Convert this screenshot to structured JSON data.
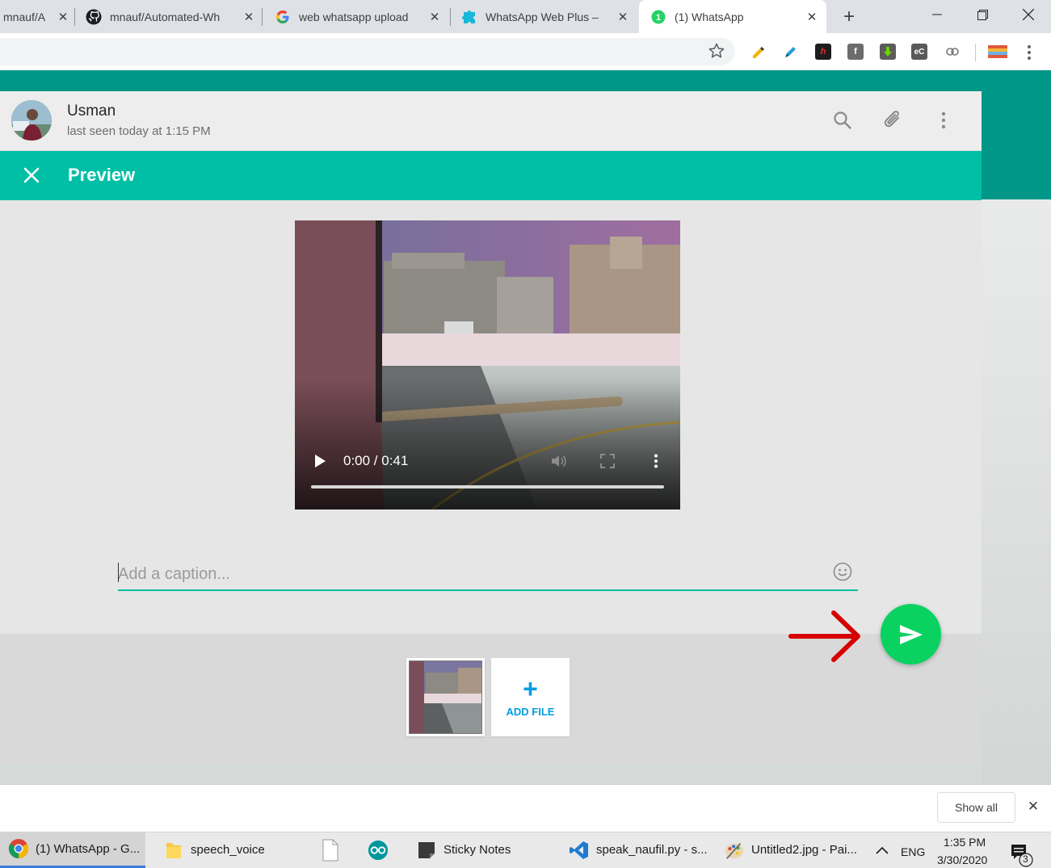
{
  "browser": {
    "tabs": [
      {
        "title": "mnauf/A",
        "favicon": "generic-page-icon"
      },
      {
        "title": "mnauf/Automated-Wh",
        "favicon": "github-icon"
      },
      {
        "title": "web whatsapp upload",
        "favicon": "google-icon"
      },
      {
        "title": "WhatsApp Web Plus –",
        "favicon": "puzzle-extension-icon"
      },
      {
        "title": "(1) WhatsApp",
        "favicon": "whatsapp-badge-icon",
        "badge": "1",
        "active": true
      }
    ],
    "extensions": [
      "highlighter-icon",
      "pen-icon",
      "h-icon",
      "facebook-icon",
      "download-icon",
      "ec-icon",
      "link-icon",
      "flag-icon"
    ]
  },
  "chat": {
    "contact_name": "Usman",
    "status": "last seen today at 1:15 PM"
  },
  "preview": {
    "title": "Preview",
    "video_time": "0:00 / 0:41",
    "caption_placeholder": "Add a caption...",
    "add_file_label": "ADD FILE",
    "add_file_plus": "+"
  },
  "download_shelf": {
    "show_all_label": "Show all"
  },
  "taskbar": {
    "items": [
      {
        "label": "(1) WhatsApp - G...",
        "icon": "chrome-icon",
        "active": true
      },
      {
        "label": "speech_voice",
        "icon": "folder-icon"
      },
      {
        "label": "",
        "icon": "file-icon"
      },
      {
        "label": "",
        "icon": "arduino-icon"
      },
      {
        "label": "Sticky Notes",
        "icon": "sticky-notes-icon"
      },
      {
        "label": "speak_naufil.py - s...",
        "icon": "vscode-icon"
      },
      {
        "label": "Untitled2.jpg - Pai...",
        "icon": "paint-icon"
      }
    ],
    "language": "ENG",
    "time": "1:35 PM",
    "date": "3/30/2020",
    "notification_count": "3"
  },
  "colors": {
    "teal_band": "#009688",
    "preview_bar": "#00bfa5",
    "send_button": "#09d261",
    "add_file_blue": "#009de2",
    "annotation_arrow": "#d60000"
  }
}
